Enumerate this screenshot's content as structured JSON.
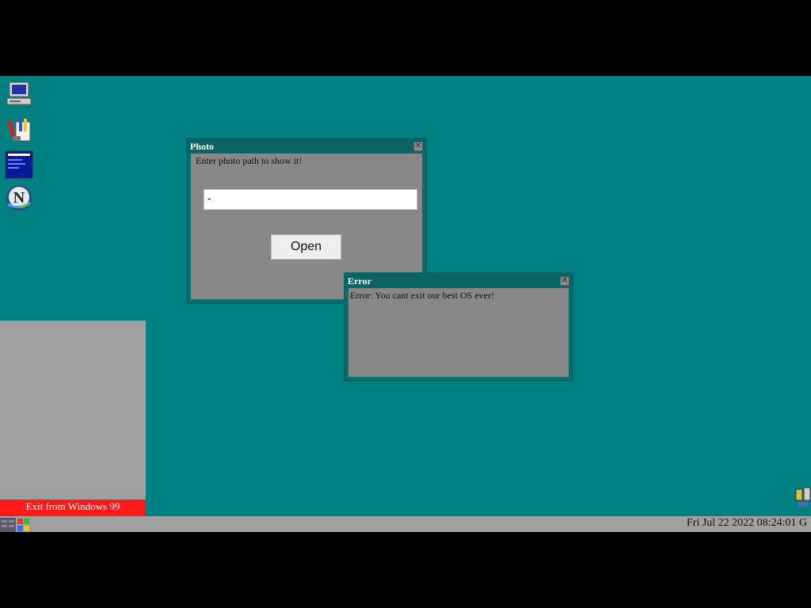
{
  "photo_window": {
    "title": "Photo",
    "prompt": "Enter photo path to show it!",
    "input_value": "-",
    "open_label": "Open"
  },
  "error_window": {
    "title": "Error",
    "message": "Error: You cant exit our best OS ever!"
  },
  "start_menu": {
    "exit_label": "Exit from Windows 99"
  },
  "taskbar": {
    "clock": "Fri Jul 22 2022 08:24:01 G"
  },
  "colors": {
    "desktop": "#008080",
    "window_frame": "#0a6464",
    "window_body": "#888888",
    "exit_button": "#ff1a1a",
    "taskbar": "#a0a0a0"
  },
  "icons": [
    "my-computer-icon",
    "paint-tools-icon",
    "blue-document-icon",
    "netscape-icon",
    "start-windows-icon",
    "tray-people-icon"
  ]
}
